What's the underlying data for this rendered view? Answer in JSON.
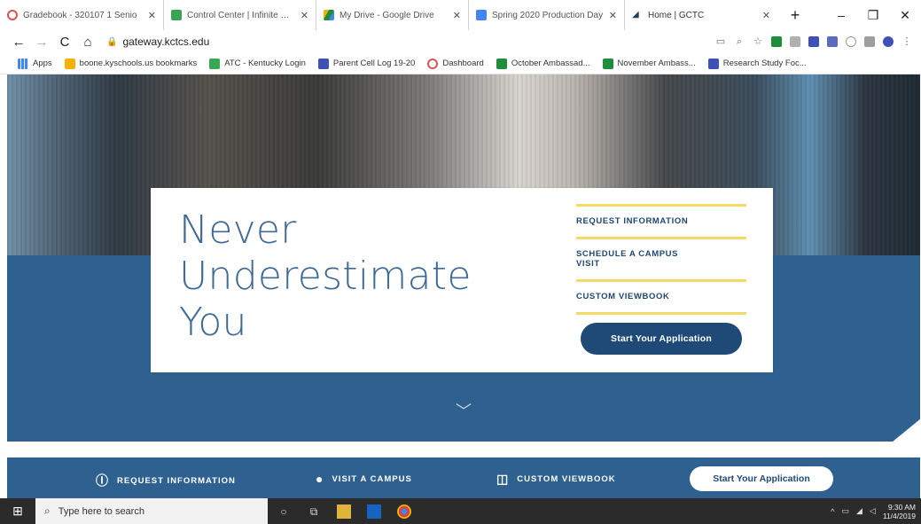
{
  "tabs": [
    {
      "title": "Gradebook - 320107 1 Senio",
      "favicon_color": "#d9534f"
    },
    {
      "title": "Control Center | Infinite Camp",
      "favicon_color": "#3aa655"
    },
    {
      "title": "My Drive - Google Drive",
      "favicon_color": "#f3b300"
    },
    {
      "title": "Spring 2020 Production Day",
      "favicon_color": "#4285f4"
    },
    {
      "title": "Home | GCTC",
      "favicon_color": "#1f3e5c"
    }
  ],
  "window_controls": {
    "minimize": "–",
    "restore": "❐",
    "close": "✕"
  },
  "address": {
    "url": "gateway.kctcs.edu"
  },
  "bookmarks": [
    {
      "label": "Apps",
      "color": "#4285f4"
    },
    {
      "label": "boone.kyschools.us bookmarks",
      "color": "#f3b300"
    },
    {
      "label": "ATC - Kentucky Login",
      "color": "#3aa655"
    },
    {
      "label": "Parent Cell Log 19-20",
      "color": "#3f51b5"
    },
    {
      "label": "Dashboard",
      "color": "#d9534f"
    },
    {
      "label": "October Ambassad...",
      "color": "#1e8e3e"
    },
    {
      "label": "November Ambass...",
      "color": "#1e8e3e"
    },
    {
      "label": "Research Study Foc...",
      "color": "#3f51b5"
    }
  ],
  "hero": {
    "headline": [
      "Never",
      "Underestimate",
      "You"
    ],
    "links": [
      "REQUEST INFORMATION",
      "SCHEDULE A CAMPUS VISIT",
      "CUSTOM VIEWBOOK"
    ],
    "cta": "Start Your Application"
  },
  "bottom_bar": {
    "items": [
      {
        "label": "REQUEST INFORMATION",
        "icon": "info-icon"
      },
      {
        "label": "VISIT A CAMPUS",
        "icon": "location-pin-icon"
      },
      {
        "label": "CUSTOM VIEWBOOK",
        "icon": "book-icon"
      }
    ],
    "cta": "Start Your Application"
  },
  "taskbar": {
    "search_placeholder": "Type here to search",
    "time": "9:30 AM",
    "date": "11/4/2019"
  },
  "colors": {
    "brand_blue": "#2f6190",
    "dark_blue": "#1f4a78",
    "accent_gold": "#f1d24a",
    "headline_blue": "#3f6a93"
  }
}
